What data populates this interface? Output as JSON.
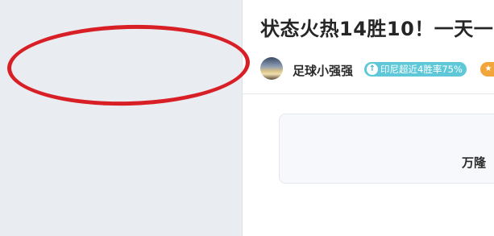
{
  "article": {
    "title": "状态火热14胜10！一天一",
    "author_name": "足球小强强",
    "badge_text": "印尼超近4胜率75%",
    "badge_icon": "arrow-up-icon",
    "star_icon": "star-icon"
  },
  "match_card": {
    "team_name": "万隆"
  },
  "colors": {
    "badge": "#5ec8d8",
    "star_badge": "#f2a53a",
    "annotation": "#d91f26",
    "left_panel": "#e9ecf0"
  }
}
